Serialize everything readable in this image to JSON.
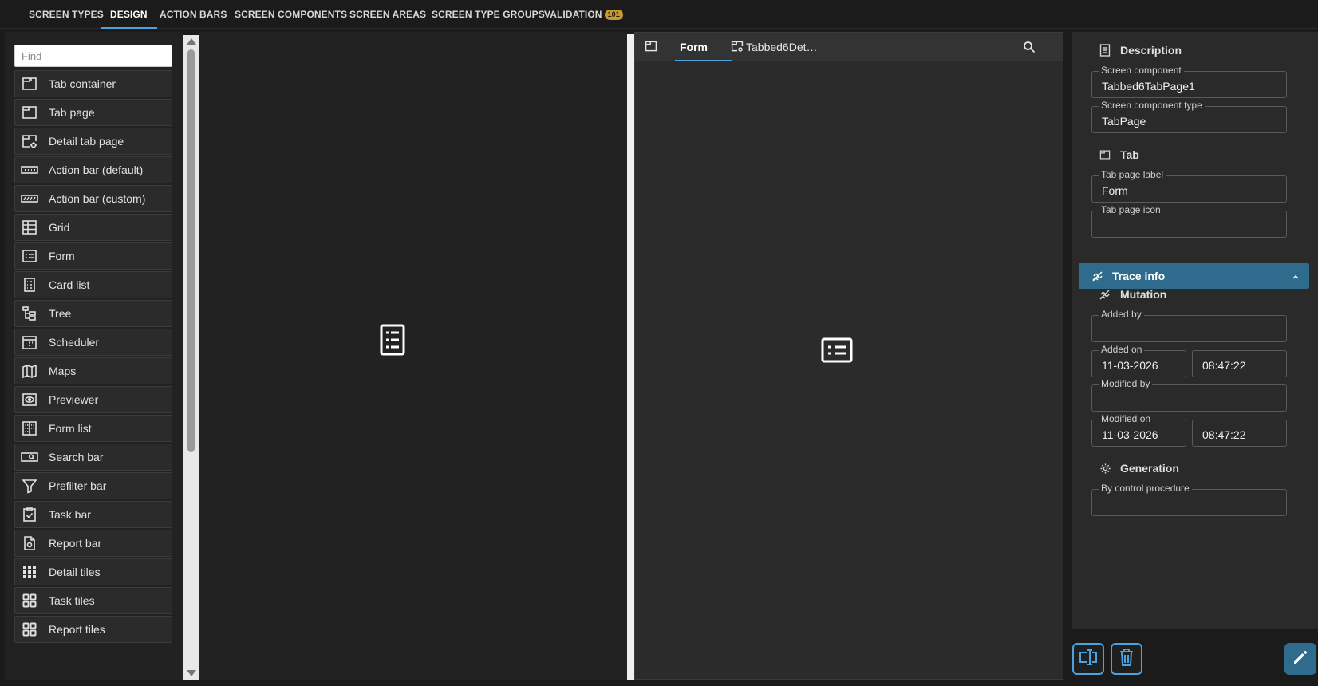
{
  "top_tabs": [
    {
      "label": "SCREEN TYPES"
    },
    {
      "label": "DESIGN"
    },
    {
      "label": "ACTION BARS"
    },
    {
      "label": "SCREEN COMPONENTS"
    },
    {
      "label": "SCREEN AREAS"
    },
    {
      "label": "SCREEN TYPE GROUPS"
    },
    {
      "label": "VALIDATION",
      "badge": "101"
    }
  ],
  "active_top_tab": "DESIGN",
  "palette": {
    "find_placeholder": "Find",
    "items": [
      {
        "label": "Tab container",
        "icon": "tab-container-icon"
      },
      {
        "label": "Tab page",
        "icon": "tab-page-icon"
      },
      {
        "label": "Detail tab page",
        "icon": "detail-tab-page-icon"
      },
      {
        "label": "Action bar (default)",
        "icon": "action-bar-default-icon"
      },
      {
        "label": "Action bar (custom)",
        "icon": "action-bar-custom-icon"
      },
      {
        "label": "Grid",
        "icon": "grid-icon"
      },
      {
        "label": "Form",
        "icon": "form-icon"
      },
      {
        "label": "Card list",
        "icon": "card-list-icon"
      },
      {
        "label": "Tree",
        "icon": "tree-icon"
      },
      {
        "label": "Scheduler",
        "icon": "scheduler-icon"
      },
      {
        "label": "Maps",
        "icon": "maps-icon"
      },
      {
        "label": "Previewer",
        "icon": "previewer-icon"
      },
      {
        "label": "Form list",
        "icon": "form-list-icon"
      },
      {
        "label": "Search bar",
        "icon": "search-bar-icon"
      },
      {
        "label": "Prefilter bar",
        "icon": "filter-icon"
      },
      {
        "label": "Task bar",
        "icon": "task-bar-icon"
      },
      {
        "label": "Report bar",
        "icon": "report-bar-icon"
      },
      {
        "label": "Detail tiles",
        "icon": "detail-tiles-icon"
      },
      {
        "label": "Task tiles",
        "icon": "task-tiles-icon"
      },
      {
        "label": "Report tiles",
        "icon": "report-tiles-icon"
      }
    ]
  },
  "canvas": {
    "tabs": [
      {
        "label": "Form",
        "icon": "tab-page-icon"
      },
      {
        "label": "Tabbed6Det…",
        "icon": "detail-tab-page-icon"
      }
    ]
  },
  "properties": {
    "description_title": "Description",
    "screen_component_label": "Screen component",
    "screen_component_value": "Tabbed6TabPage1",
    "screen_component_type_label": "Screen component type",
    "screen_component_type_value": "TabPage",
    "tab_title": "Tab",
    "tab_page_label_label": "Tab page label",
    "tab_page_label_value": "Form",
    "tab_page_icon_label": "Tab page icon",
    "tab_page_icon_value": "",
    "trace_info_title": "Trace info",
    "mutation_title": "Mutation",
    "added_by_label": "Added by",
    "added_by_value": "",
    "added_on_label": "Added on",
    "added_on_date": "11-03-2026",
    "added_on_time": "08:47:22",
    "modified_by_label": "Modified by",
    "modified_by_value": "",
    "modified_on_label": "Modified on",
    "modified_on_date": "11-03-2026",
    "modified_on_time": "08:47:22",
    "generation_title": "Generation",
    "by_control_procedure_label": "By control procedure",
    "by_control_procedure_value": ""
  },
  "colors": {
    "accent": "#4aa3df",
    "trace_header": "#2f6b8c",
    "badge": "#c99a2e"
  }
}
